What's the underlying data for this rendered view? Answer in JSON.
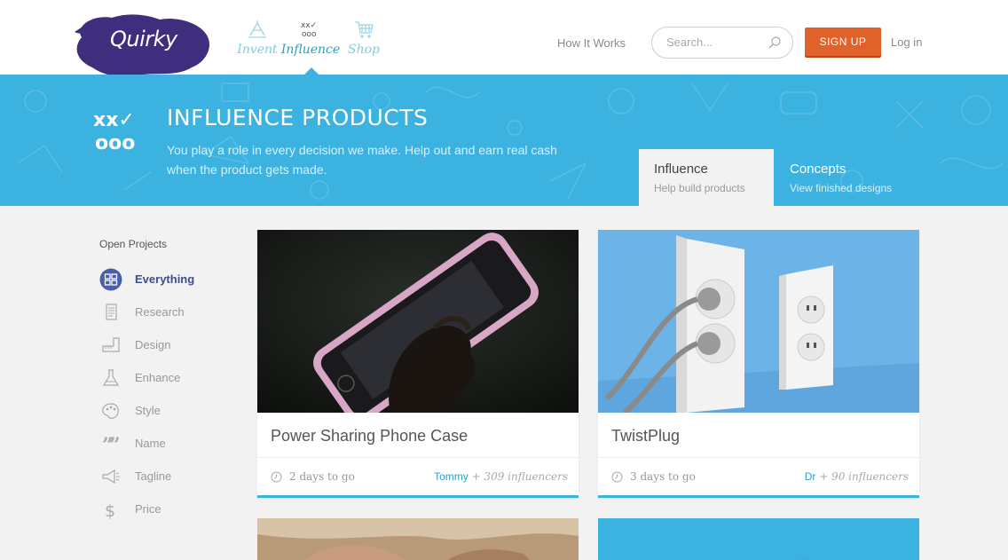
{
  "app": {
    "logo_text": "Quirky",
    "brand_colors": {
      "primary_blue": "#3cb2e0",
      "accent_orange": "#e0622a",
      "logo_purple": "#3f2d7e"
    }
  },
  "nav": {
    "items": [
      {
        "label": "Invent",
        "icon": "lightbulb-icon",
        "active": false
      },
      {
        "label": "Influence",
        "icon": "xxv-ooo-icon",
        "active": true
      },
      {
        "label": "Shop",
        "icon": "shopping-cart-icon",
        "active": false
      }
    ]
  },
  "header": {
    "how_it_works": "How It Works",
    "search_placeholder": "Search...",
    "signup_label": "SIGN UP",
    "login_label": "Log in"
  },
  "hero": {
    "title": "INFLUENCE PRODUCTS",
    "description": "You play a role in every decision we make. Help out and earn real cash when the product gets made.",
    "tabs": [
      {
        "title": "Influence",
        "subtitle": "Help build products",
        "active": true
      },
      {
        "title": "Concepts",
        "subtitle": "View finished designs",
        "active": false
      }
    ]
  },
  "sidebar": {
    "title": "Open Projects",
    "items": [
      {
        "label": "Everything",
        "icon": "grid-icon",
        "active": true
      },
      {
        "label": "Research",
        "icon": "document-icon",
        "active": false
      },
      {
        "label": "Design",
        "icon": "ruler-icon",
        "active": false
      },
      {
        "label": "Enhance",
        "icon": "flask-icon",
        "active": false
      },
      {
        "label": "Style",
        "icon": "palette-icon",
        "active": false
      },
      {
        "label": "Name",
        "icon": "quote-icon",
        "active": false
      },
      {
        "label": "Tagline",
        "icon": "megaphone-icon",
        "active": false
      },
      {
        "label": "Price",
        "icon": "dollar-icon",
        "active": false
      }
    ]
  },
  "cards": [
    {
      "title": "Power Sharing Phone Case",
      "days": "2 days to go",
      "user": "Tommy",
      "influencers": "+ 309 influencers"
    },
    {
      "title": "TwistPlug",
      "days": "3 days to go",
      "user": "Dr",
      "influencers": "+ 90 influencers"
    }
  ]
}
